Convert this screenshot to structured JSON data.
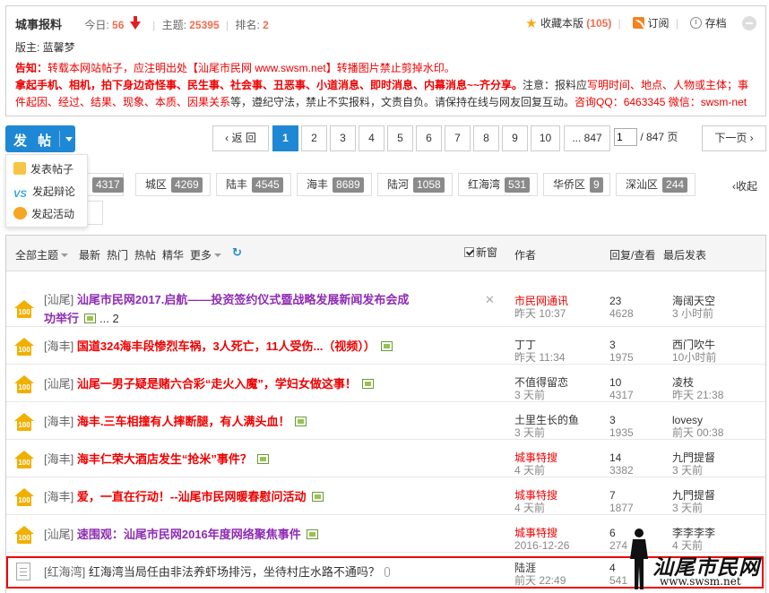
{
  "forum": {
    "name": "城事报料",
    "today_label": "今日:",
    "today_value": "56",
    "topics_label": "主题:",
    "topics_value": "25395",
    "rank_label": "排名:",
    "rank_value": "2",
    "favorite_label": "收藏本版",
    "favorite_count": "(105)",
    "subscribe_label": "订阅",
    "archive_label": "存档",
    "moderator": "版主: 蓝馨梦",
    "notice": {
      "warn_prefix": "告知：",
      "warn_text": "转载本网站帖子，应注明出处【汕尾市民网 www.swsm.net】转播图片禁止剪掉水印。",
      "line2_bold": "拿起手机、相机，拍下身边奇怪事、民生事、社会事、丑恶事、小道消息、即时消息、内幕消息~~齐分享。",
      "line2_a": "注意：报料应",
      "line2_red1": "写明时间、地点、人物或主体；事件起因、经过、结果、现象、本质、因果关系",
      "line2_b": "等，遵纪守法，禁止不实报料，文责自负。请保持在线与网友回复互动。",
      "line2_red2": "咨询QQ：6463345 微信：swsm-net"
    }
  },
  "post_button": "发 帖",
  "post_menu": [
    "发表帖子",
    "发起辩论",
    "发起活动"
  ],
  "pager": {
    "back": "返 回",
    "pages": [
      "1",
      "2",
      "3",
      "4",
      "5",
      "6",
      "7",
      "8",
      "9",
      "10"
    ],
    "last": "... 847",
    "input_value": "1",
    "total": "/ 847 页",
    "next": "下一页"
  },
  "regions": [
    {
      "name": "城区",
      "count": "4269"
    },
    {
      "name": "陆丰",
      "count": "4545"
    },
    {
      "name": "海丰",
      "count": "8689"
    },
    {
      "name": "陆河",
      "count": "1058"
    },
    {
      "name": "红海湾",
      "count": "531"
    },
    {
      "name": "华侨区",
      "count": "9"
    },
    {
      "name": "深汕区",
      "count": "244"
    }
  ],
  "region_partial_count": "4317",
  "collapse_label": "收起",
  "list_header": {
    "all": "全部主题",
    "latest": "最新",
    "hot": "热门",
    "hot_posts": "热帖",
    "digest": "精华",
    "more": "更多",
    "new_window": "新窗",
    "author": "作者",
    "reply_view": "回复/查看",
    "last_post": "最后发表"
  },
  "threads": [
    {
      "tag": "[汕尾]",
      "title": "汕尾市民网2017.启航——投资签约仪式暨战略发展新闻发布会成",
      "title2": "功举行",
      "pages": "... 2",
      "author": "市民网通讯",
      "author_red": true,
      "date": "昨天 10:37",
      "replies": "23",
      "views": "4628",
      "last_user": "海阔天空",
      "last_time": "3 小时前"
    },
    {
      "tag": "[海丰]",
      "title": "国道324海丰段惨烈车祸，3人死亡，11人受伤...（视频））",
      "author": "丁丁",
      "date": "昨天 11:34",
      "replies": "3",
      "views": "1975",
      "last_user": "西门吹牛",
      "last_time": "10小时前"
    },
    {
      "tag": "[汕尾]",
      "title": "汕尾一男子疑是赌六合彩“走火入魔”，学妇女做这事！",
      "author": "不值得留恋",
      "date": "3 天前",
      "replies": "10",
      "views": "4317",
      "last_user": "凌枝",
      "last_time": "昨天 21:38"
    },
    {
      "tag": "[海丰]",
      "title": "海丰.三车相撞有人摔断腿，有人满头血！",
      "author": "土里生长的鱼",
      "date": "3 天前",
      "replies": "3",
      "views": "1935",
      "last_user": "lovesy",
      "last_time": "前天 00:38"
    },
    {
      "tag": "[海丰]",
      "title": "海丰仁荣大酒店发生“抢米”事件？",
      "author": "城事特搜",
      "author_red": true,
      "date": "4 天前",
      "replies": "14",
      "views": "3382",
      "last_user": "九門提督",
      "last_time": "3 天前"
    },
    {
      "tag": "[海丰]",
      "title": "爱，一直在行动！--汕尾市民网暖春慰问活动",
      "author": "城事特搜",
      "author_red": true,
      "date": "4 天前",
      "replies": "7",
      "views": "1877",
      "last_user": "九門提督",
      "last_time": "3 天前"
    },
    {
      "tag": "[汕尾]",
      "title": "速围观：汕尾市民网2016年度网络聚焦事件",
      "author": "城事特搜",
      "author_red": true,
      "date": "2016-12-26",
      "replies": "6",
      "views": "274",
      "last_user": "李李李李",
      "last_time": "4 天前"
    },
    {
      "tag": "[红海湾]",
      "title": "红海湾当局任由非法养虾场排污，坐待村庄水路不通吗？",
      "author": "陆涯",
      "date": "前天 22:49",
      "replies": "4",
      "views": "541",
      "last_user": "",
      "last_time": ""
    }
  ],
  "watermark": {
    "text": "汕尾市民网",
    "url": "www.swsm.net"
  },
  "colors": {
    "accent": "#1e88d4",
    "stat_orange": "#f26c4f",
    "title_purple": "#8e2bb4",
    "title_red": "#e00000",
    "highlight_border": "#e00000"
  }
}
